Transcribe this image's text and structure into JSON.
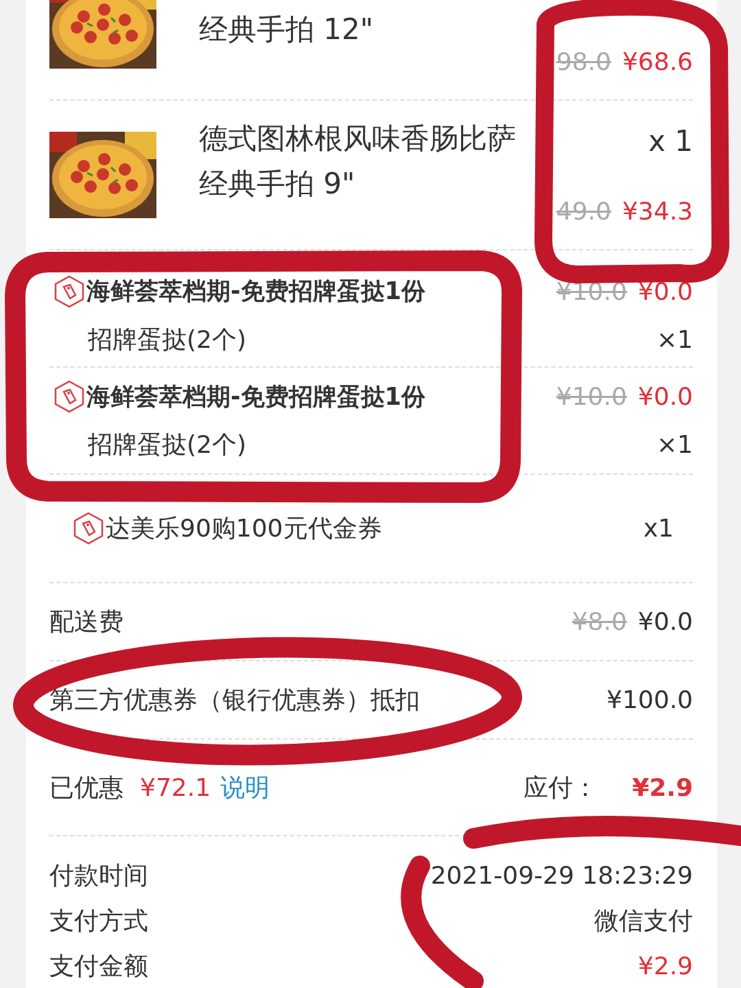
{
  "products": [
    {
      "subtitle": "经典手拍 12\"",
      "original_price": "98.0",
      "price": "¥68.6"
    },
    {
      "title": "德式图林根风味香肠比萨",
      "subtitle": "经典手拍 9\"",
      "quantity": "x 1",
      "original_price": "49.0",
      "price": "¥34.3"
    }
  ],
  "gifts": [
    {
      "title": "海鲜荟萃档期-免费招牌蛋挞1份",
      "subtitle": "招牌蛋挞(2个)",
      "original_price": "¥10.0",
      "price": "¥0.0",
      "quantity": "×1"
    },
    {
      "title": "海鲜荟萃档期-免费招牌蛋挞1份",
      "subtitle": "招牌蛋挞(2个)",
      "original_price": "¥10.0",
      "price": "¥0.0",
      "quantity": "×1"
    }
  ],
  "voucher": {
    "title": "达美乐90购100元代金券",
    "quantity": "x1"
  },
  "fees": [
    {
      "label": "配送费",
      "original_price": "¥8.0",
      "price": "¥0.0"
    },
    {
      "label": "第三方优惠券（银行优惠券）抵扣",
      "price": "¥100.0"
    }
  ],
  "summary": {
    "discount_label": "已优惠",
    "discount": "¥72.1",
    "explain_link": "说明",
    "due_label": "应付：",
    "due": "¥2.9"
  },
  "payment": [
    {
      "label": "付款时间",
      "value": "2021-09-29 18:23:29",
      "kind": "plain"
    },
    {
      "label": "支付方式",
      "value": "微信支付",
      "kind": "plain"
    },
    {
      "label": "支付金额",
      "value": "¥2.9",
      "kind": "amount"
    }
  ],
  "annotations": [
    {
      "kind": "box"
    },
    {
      "kind": "loop"
    },
    {
      "kind": "loop"
    },
    {
      "kind": "arc"
    }
  ]
}
